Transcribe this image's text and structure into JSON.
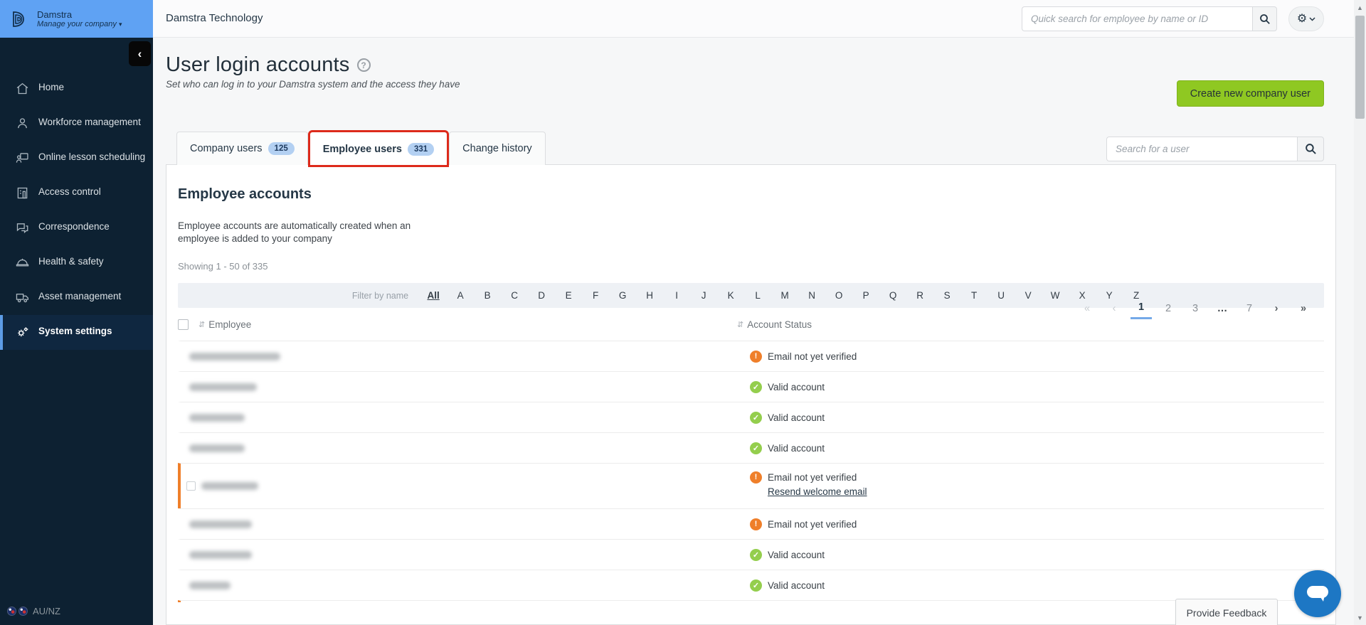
{
  "brand": {
    "name": "Damstra",
    "tagline": "Manage your company",
    "region": "AU/NZ"
  },
  "topbar": {
    "company": "Damstra Technology",
    "search_placeholder": "Quick search for employee by name or ID"
  },
  "sidebar": {
    "items": [
      {
        "label": "Home"
      },
      {
        "label": "Workforce management"
      },
      {
        "label": "Online lesson scheduling"
      },
      {
        "label": "Access control"
      },
      {
        "label": "Correspondence"
      },
      {
        "label": "Health & safety"
      },
      {
        "label": "Asset management"
      },
      {
        "label": "System settings",
        "active": true
      }
    ]
  },
  "page": {
    "title": "User login accounts",
    "help_icon": "?",
    "subtitle": "Set who can log in to your Damstra system and the access they have",
    "create_button": "Create new company user",
    "tabs": [
      {
        "label": "Company users",
        "count": "125"
      },
      {
        "label": "Employee users",
        "count": "331",
        "active": true
      },
      {
        "label": "Change history"
      }
    ],
    "user_search_placeholder": "Search for a user",
    "section": {
      "heading": "Employee accounts",
      "description": "Employee accounts are automatically created when an employee is added to your company",
      "showing": "Showing 1 - 50 of 335",
      "pagination": [
        {
          "label": "«",
          "cls": "dis"
        },
        {
          "label": "‹",
          "cls": "dis"
        },
        {
          "label": "1",
          "active": true
        },
        {
          "label": "2"
        },
        {
          "label": "3"
        },
        {
          "label": "…",
          "cls": "dots"
        },
        {
          "label": "7"
        },
        {
          "label": "›",
          "cls": "arrow"
        },
        {
          "label": "»",
          "cls": "arrow"
        }
      ],
      "filter_label": "Filter by name",
      "filters": [
        {
          "label": "All",
          "active": true
        },
        {
          "label": "A"
        },
        {
          "label": "B"
        },
        {
          "label": "C"
        },
        {
          "label": "D"
        },
        {
          "label": "E"
        },
        {
          "label": "F"
        },
        {
          "label": "G"
        },
        {
          "label": "H"
        },
        {
          "label": "I"
        },
        {
          "label": "J"
        },
        {
          "label": "K"
        },
        {
          "label": "L"
        },
        {
          "label": "M"
        },
        {
          "label": "N"
        },
        {
          "label": "O"
        },
        {
          "label": "P"
        },
        {
          "label": "Q"
        },
        {
          "label": "R"
        },
        {
          "label": "S"
        },
        {
          "label": "T"
        },
        {
          "label": "U"
        },
        {
          "label": "V"
        },
        {
          "label": "W"
        },
        {
          "label": "X"
        },
        {
          "label": "Y"
        },
        {
          "label": "Z"
        }
      ],
      "columns": {
        "employee": "Employee",
        "status": "Account Status"
      },
      "rows": [
        {
          "status": "Email not yet verified",
          "state": "warning"
        },
        {
          "status": "Valid account",
          "state": "ok"
        },
        {
          "status": "Valid account",
          "state": "ok"
        },
        {
          "status": "Valid account",
          "state": "ok"
        },
        {
          "status": "Email not yet verified",
          "state": "warning",
          "highlighted": true,
          "link": "Resend welcome email"
        },
        {
          "status": "Email not yet verified",
          "state": "warning"
        },
        {
          "status": "Valid account",
          "state": "ok"
        },
        {
          "status": "Valid account",
          "state": "ok"
        }
      ]
    }
  },
  "footer": {
    "feedback_button": "Provide Feedback"
  },
  "colors": {
    "accent_green": "#8fc822",
    "warning_orange": "#ef7f2a",
    "success_green": "#94ce4d",
    "annotation_red": "#dd2a1b",
    "active_blue": "#74a9e8",
    "sidebar_navy": "#0d2132",
    "brand_blue": "#5fa2f3"
  }
}
